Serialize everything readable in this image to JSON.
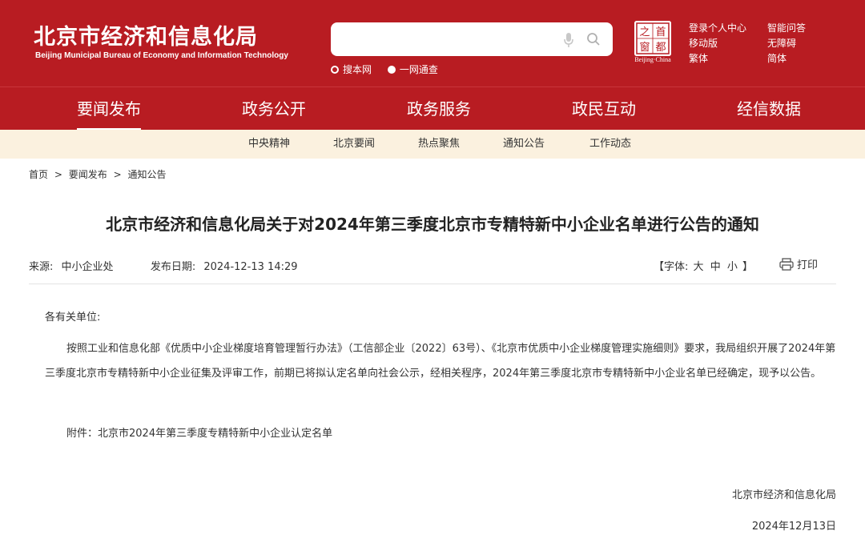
{
  "header": {
    "title_cn": "北京市经济和信息化局",
    "title_en": "Beijing Municipal Bureau of Economy and Information Technology",
    "search": {
      "value": "",
      "placeholder": ""
    },
    "search_options": [
      {
        "label": "搜本网",
        "selected": false
      },
      {
        "label": "一网通查",
        "selected": true
      }
    ],
    "seal": {
      "chars": [
        "之",
        "首",
        "窗",
        "都"
      ],
      "caption": "Beijing·China"
    },
    "quick_links": [
      "登录个人中心",
      "智能问答",
      "移动版",
      "无障碍",
      "繁体",
      "简体"
    ]
  },
  "main_nav": {
    "items": [
      "要闻发布",
      "政务公开",
      "政务服务",
      "政民互动",
      "经信数据"
    ],
    "active": "要闻发布"
  },
  "sub_nav": {
    "items": [
      "中央精神",
      "北京要闻",
      "热点聚焦",
      "通知公告",
      "工作动态"
    ]
  },
  "breadcrumb": {
    "items": [
      "首页",
      "要闻发布",
      "通知公告"
    ],
    "separator": ">"
  },
  "article": {
    "title": "北京市经济和信息化局关于对2024年第三季度北京市专精特新中小企业名单进行公告的通知",
    "source_label": "来源:",
    "source": "中小企业处",
    "date_label": "发布日期:",
    "date": "2024-12-13 14:29",
    "font_label": "【字体:",
    "font_sizes": [
      "大",
      "中",
      "小"
    ],
    "font_close": "】",
    "print_label": "打印",
    "salutation": "各有关单位:",
    "body": "按照工业和信息化部《优质中小企业梯度培育管理暂行办法》（工信部企业〔2022〕63号）、《北京市优质中小企业梯度管理实施细则》要求，我局组织开展了2024年第三季度北京市专精特新中小企业征集及评审工作，前期已将拟认定名单向社会公示，经相关程序，2024年第三季度北京市专精特新中小企业名单已经确定，现予以公告。",
    "attachment": "附件：北京市2024年第三季度专精特新中小企业认定名单",
    "signature": "北京市经济和信息化局",
    "sign_date": "2024年12月13日"
  },
  "colors": {
    "brand_red": "#b81c22",
    "subnav_bg": "#fbf1df"
  }
}
